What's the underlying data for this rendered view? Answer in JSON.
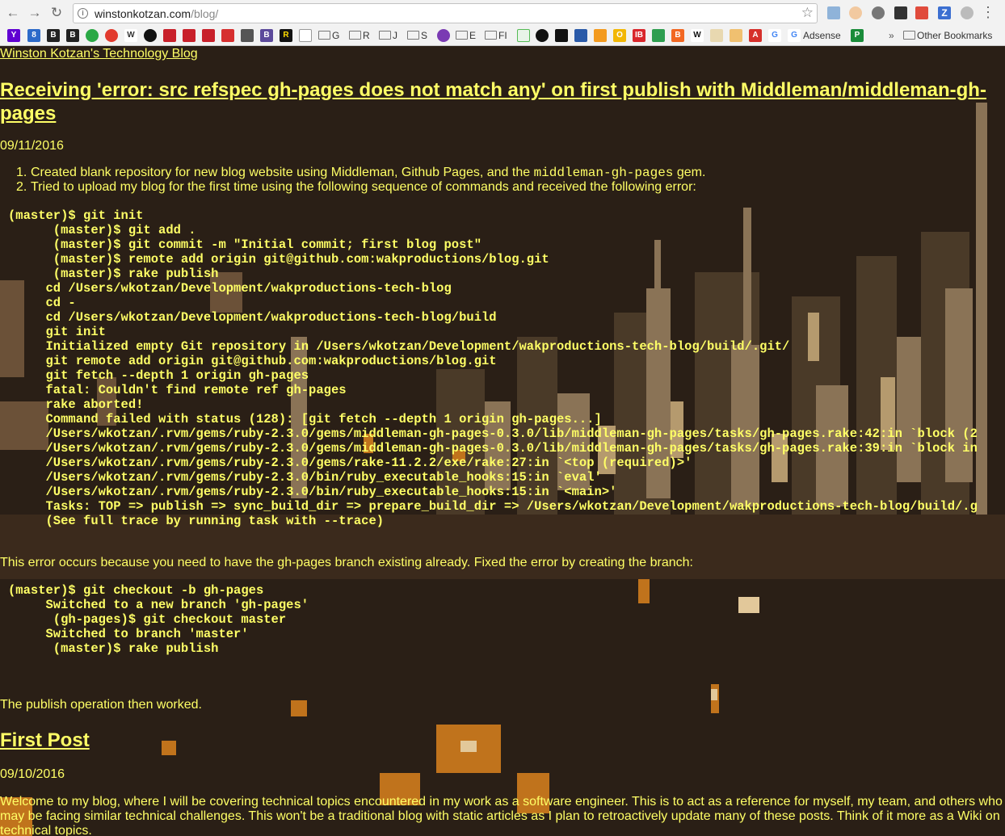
{
  "browser": {
    "url_host": "winstonkotzan.com",
    "url_path": "/blog/",
    "bookmarks": {
      "folders": [
        "G",
        "R",
        "J",
        "S",
        "E",
        "FI"
      ],
      "adsense_label": "Adsense",
      "other_label": "Other Bookmarks",
      "overflow": "»"
    }
  },
  "site": {
    "title": "Winston Kotzan's Technology Blog"
  },
  "post1": {
    "title": "Receiving 'error: src refspec gh-pages does not match any' on first publish with Middleman/middleman-gh-pages",
    "date": "09/11/2016",
    "step1_prefix": "Created blank repository for new blog website using Middleman, Github Pages, and the ",
    "step1_code": "middleman-gh-pages",
    "step1_suffix": " gem.",
    "step2": "Tried to upload my blog for the first time using the following sequence of commands and received the following error:",
    "code1": [
      "(master)$ git init",
      "      (master)$ git add .",
      "      (master)$ git commit -m \"Initial commit; first blog post\"",
      "      (master)$ remote add origin git@github.com:wakproductions/blog.git",
      "      (master)$ rake publish",
      "     cd /Users/wkotzan/Development/wakproductions-tech-blog",
      "     cd -",
      "     cd /Users/wkotzan/Development/wakproductions-tech-blog/build",
      "     git init",
      "     Initialized empty Git repository in /Users/wkotzan/Development/wakproductions-tech-blog/build/.git/",
      "     git remote add origin git@github.com:wakproductions/blog.git",
      "     git fetch --depth 1 origin gh-pages",
      "     fatal: Couldn't find remote ref gh-pages",
      "     rake aborted!",
      "     Command failed with status (128): [git fetch --depth 1 origin gh-pages...]",
      "     /Users/wkotzan/.rvm/gems/ruby-2.3.0/gems/middleman-gh-pages-0.3.0/lib/middleman-gh-pages/tasks/gh-pages.rake:42:in `block (2",
      "     /Users/wkotzan/.rvm/gems/ruby-2.3.0/gems/middleman-gh-pages-0.3.0/lib/middleman-gh-pages/tasks/gh-pages.rake:39:in `block in",
      "     /Users/wkotzan/.rvm/gems/ruby-2.3.0/gems/rake-11.2.2/exe/rake:27:in `<top (required)>'",
      "     /Users/wkotzan/.rvm/gems/ruby-2.3.0/bin/ruby_executable_hooks:15:in `eval'",
      "     /Users/wkotzan/.rvm/gems/ruby-2.3.0/bin/ruby_executable_hooks:15:in `<main>'",
      "     Tasks: TOP => publish => sync_build_dir => prepare_build_dir => /Users/wkotzan/Development/wakproductions-tech-blog/build/.g",
      "     (See full trace by running task with --trace)"
    ],
    "explanation": "This error occurs because you need to have the gh-pages branch existing already. Fixed the error by creating the branch:",
    "code2": [
      "(master)$ git checkout -b gh-pages",
      "     Switched to a new branch 'gh-pages'",
      "      (gh-pages)$ git checkout master",
      "     Switched to branch 'master'",
      "      (master)$ rake publish"
    ],
    "conclusion": "The publish operation then worked."
  },
  "post2": {
    "title": "First Post",
    "date": "09/10/2016",
    "body": "Welcome to my blog, where I will be covering technical topics encountered in my work as a software engineer. This is to act as a reference for myself, my team, and others who may be facing similar technical challenges. This won't be a traditional blog with static articles as I plan to retroactively update many of these posts. Think of it more as a Wiki on technical topics."
  },
  "colors": {
    "text": "#ffff66",
    "background": "#2a1f16"
  }
}
